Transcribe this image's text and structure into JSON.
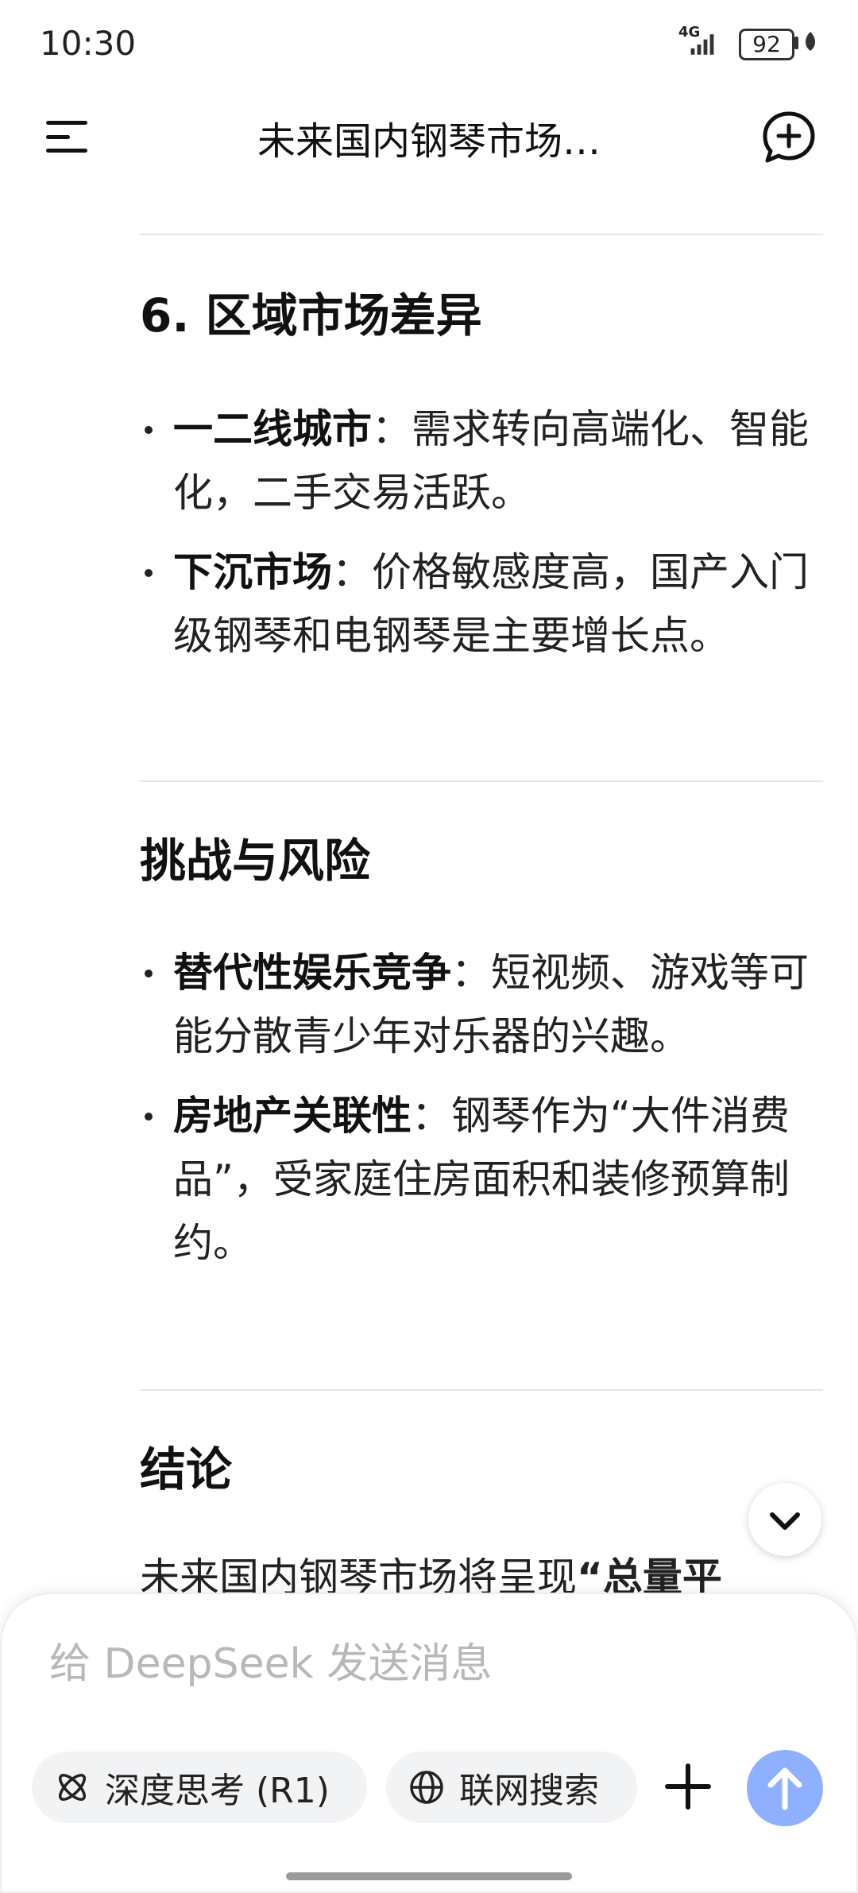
{
  "status_bar": {
    "time": "10:30",
    "network": "4G",
    "battery": "92"
  },
  "header": {
    "title": "未来国内钢琴市场…"
  },
  "sections": [
    {
      "heading": "6. 区域市场差异",
      "items": [
        {
          "bold": "一二线城市",
          "text": "：需求转向高端化、智能化，二手交易活跃。"
        },
        {
          "bold": "下沉市场",
          "text": "：价格敏感度高，国产入门级钢琴和电钢琴是主要增长点。"
        }
      ]
    },
    {
      "heading": "挑战与风险",
      "items": [
        {
          "bold": "替代性娱乐竞争",
          "text": "：短视频、游戏等可能分散青少年对乐器的兴趣。"
        },
        {
          "bold": "房地产关联性",
          "text": "：钢琴作为“大件消费品”，受家庭住房面积和装修预算制约。"
        }
      ]
    },
    {
      "heading": "结论",
      "partial_text": "未来国内钢琴市场将呈现",
      "partial_bold": "“总量平"
    }
  ],
  "composer": {
    "placeholder": "给 DeepSeek 发送消息",
    "deep_think_label": "深度思考 (R1)",
    "web_search_label": "联网搜索"
  },
  "colors": {
    "accent_send": "#8fb0ff",
    "pill_bg": "#f2f3f5",
    "divider": "#e6e6e6"
  }
}
